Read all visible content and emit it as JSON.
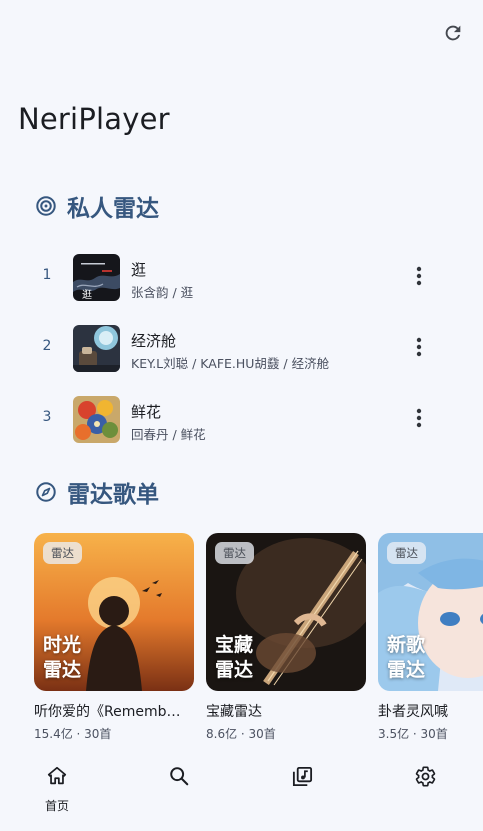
{
  "app": {
    "title": "NeriPlayer"
  },
  "toolbar": {
    "refresh_icon": "refresh-icon"
  },
  "radar": {
    "title": "私人雷达",
    "icon": "radar-icon",
    "tracks": [
      {
        "index": "1",
        "title": "逛",
        "subtitle": "张含韵 / 逛"
      },
      {
        "index": "2",
        "title": "经济舱",
        "subtitle": "KEY.L刘聪 / KAFE.HU胡鼗 / 经济舱"
      },
      {
        "index": "3",
        "title": "鲜花",
        "subtitle": "回春丹 / 鲜花"
      }
    ]
  },
  "playlists": {
    "title": "雷达歌单",
    "icon": "compass-icon",
    "cards": [
      {
        "tag": "雷达",
        "big_line1": "时光",
        "big_line2": "雷达",
        "title": "听你爱的《Rememb…",
        "meta": "15.4亿 · 30首"
      },
      {
        "tag": "雷达",
        "big_line1": "宝藏",
        "big_line2": "雷达",
        "title": "宝藏雷达",
        "meta": "8.6亿 · 30首"
      },
      {
        "tag": "雷达",
        "big_line1": "新歌",
        "big_line2": "雷达",
        "title": "卦者灵风喊",
        "meta": "3.5亿 · 30首"
      }
    ]
  },
  "nav": {
    "home_label": "首页",
    "items": [
      "home-icon",
      "search-icon",
      "library-icon",
      "settings-icon"
    ]
  },
  "colors": {
    "accent": "#36577f",
    "background": "#f5f7fc",
    "text": "#1b1d22"
  }
}
